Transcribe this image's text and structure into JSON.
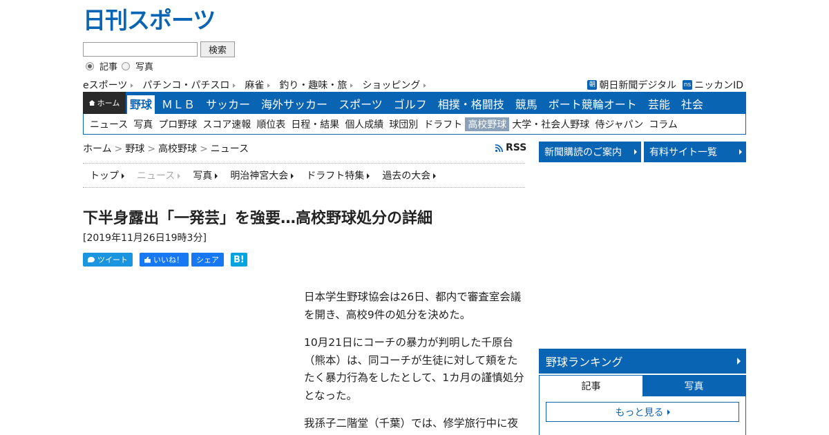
{
  "header": {
    "logo_text": "日刊スポーツ",
    "search": {
      "value": "",
      "button": "検索"
    },
    "radios": [
      {
        "label": "記事",
        "checked": true
      },
      {
        "label": "写真",
        "checked": false
      }
    ],
    "top_links": [
      "eスポーツ",
      "パチンコ・パチスロ",
      "麻雀",
      "釣り・趣味・旅",
      "ショッピング"
    ],
    "right_links": [
      {
        "badge": "朝",
        "label": "朝日新聞デジタル"
      },
      {
        "badge": "ns",
        "label": "ニッカンID"
      }
    ]
  },
  "main_nav": {
    "home": "ホーム",
    "items": [
      "野球",
      "ＭＬＢ",
      "サッカー",
      "海外サッカー",
      "スポーツ",
      "ゴルフ",
      "相撲・格闘技",
      "競馬",
      "ボート競輪オート",
      "芸能",
      "社会"
    ],
    "active_index": 0
  },
  "sub_nav": {
    "items": [
      "ニュース",
      "写真",
      "プロ野球",
      "スコア速報",
      "順位表",
      "日程・結果",
      "個人成績",
      "球団別",
      "ドラフト",
      "高校野球",
      "大学・社会人野球",
      "侍ジャパン",
      "コラム"
    ],
    "active_index": 9
  },
  "breadcrumb": [
    "ホーム",
    "野球",
    "高校野球",
    "ニュース"
  ],
  "breadcrumb_sep": ">",
  "rss_label": "RSS",
  "article_tabs": [
    {
      "label": "トップ",
      "current": false
    },
    {
      "label": "ニュース",
      "current": true
    },
    {
      "label": "写真",
      "current": false
    },
    {
      "label": "明治神宮大会",
      "current": false
    },
    {
      "label": "ドラフト特集",
      "current": false
    },
    {
      "label": "過去の大会",
      "current": false
    }
  ],
  "article": {
    "title": "下半身露出「一発芸」を強要…高校野球処分の詳細",
    "date": "[2019年11月26日19時3分]",
    "social": {
      "tweet": "ツイート",
      "like": "いいね！",
      "share": "シェア",
      "hatena": "B!"
    },
    "paragraphs": [
      "日本学生野球協会は26日、都内で審査室会議を開き、高校9件の処分を決めた。",
      "10月21日にコーチの暴力が判明した千原台（熊本）は、同コーチが生徒に対して頬をたたく暴力行為をしたとして、1カ月の謹慎処分となった。",
      "我孫子二階堂（千葉）では、修学旅行中に夜"
    ]
  },
  "sidebar": {
    "buttons": [
      "新聞購読のご案内",
      "有料サイト一覧"
    ],
    "ranking": {
      "title": "野球ランキング",
      "tabs": [
        "記事",
        "写真"
      ],
      "more": "もっと見る"
    }
  }
}
